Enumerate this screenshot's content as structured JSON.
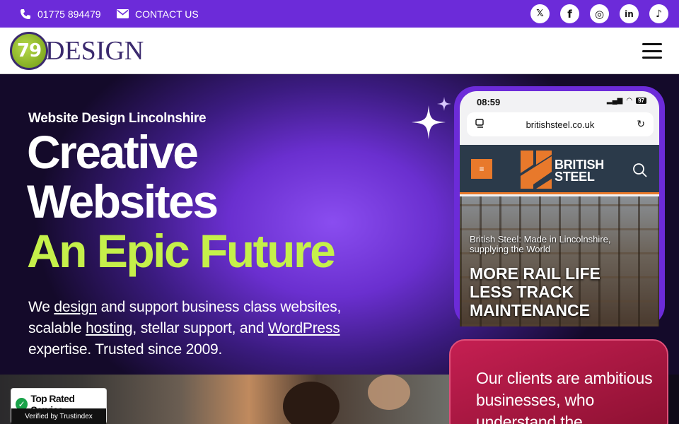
{
  "topbar": {
    "phone": "01775 894479",
    "contact": "CONTACT US",
    "social": [
      {
        "icon": "x-icon",
        "glyph": "𝕏"
      },
      {
        "icon": "facebook-icon",
        "glyph": "f"
      },
      {
        "icon": "instagram-icon",
        "glyph": "◎"
      },
      {
        "icon": "linkedin-icon",
        "glyph": "in"
      },
      {
        "icon": "tiktok-icon",
        "glyph": "♪"
      }
    ]
  },
  "header": {
    "logo_number": "79",
    "logo_word": "DESIGN"
  },
  "hero": {
    "kicker": "Website Design Lincolnshire",
    "line1": "Creative",
    "line2": "Websites",
    "line3": "An Epic Future",
    "intro": {
      "p1": "We ",
      "link_design": "design",
      "p2": " and support business class websites, scalable ",
      "link_hosting": "hosting",
      "p3": ", stellar support, and ",
      "link_wordpress": "WordPress",
      "p4": " expertise. Trusted since 2009."
    }
  },
  "phone_mockup": {
    "time": "08:59",
    "battery": "97",
    "url": "britishsteel.co.uk",
    "brand_line1": "BRITISH",
    "brand_line2": "STEEL",
    "sub_line1": "British Steel: Made in Lincolnshire,",
    "sub_line2": "supplying the World",
    "big_line1": "MORE RAIL LIFE",
    "big_line2": "LESS TRACK",
    "big_line3": "MAINTENANCE"
  },
  "badge": {
    "title": "Top Rated Service",
    "verified": "Verified by Trustindex"
  },
  "card": {
    "text": "Our clients are ambitious businesses, who understand the"
  },
  "colors": {
    "brand_purple": "#6c2bd9",
    "accent_green": "#c5f04a",
    "card_red": "#c51f52"
  }
}
